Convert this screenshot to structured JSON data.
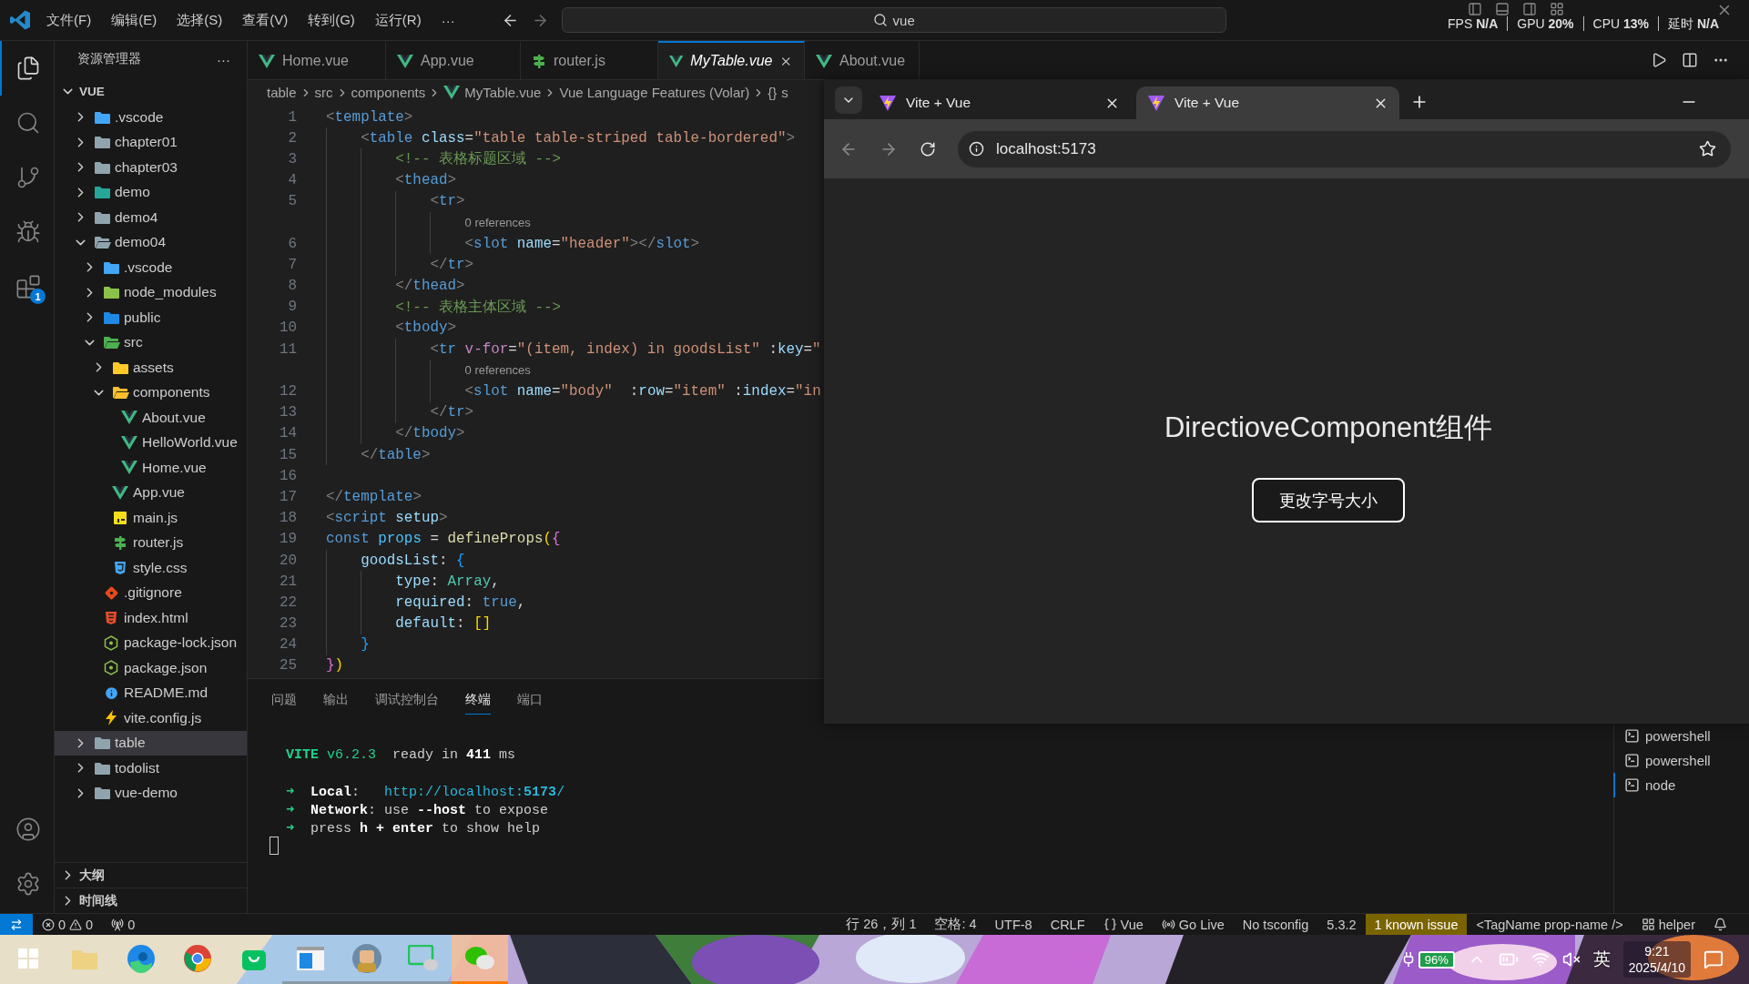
{
  "title_bar": {
    "menus": [
      "文件(F)",
      "编辑(E)",
      "选择(S)",
      "查看(V)",
      "转到(G)",
      "运行(R)"
    ],
    "more": "···",
    "search": {
      "value": "vue"
    },
    "stats": [
      {
        "label": "FPS",
        "value": "N/A"
      },
      {
        "label": "GPU",
        "value": "20%"
      },
      {
        "label": "CPU",
        "value": "13%"
      },
      {
        "label": "延时",
        "value": "N/A"
      }
    ]
  },
  "activity_bar": {
    "items": [
      {
        "kind": "explorer",
        "selected": true
      },
      {
        "kind": "search",
        "selected": false
      },
      {
        "kind": "source-control",
        "selected": false
      },
      {
        "kind": "run-debug",
        "selected": false
      },
      {
        "kind": "extensions",
        "selected": false,
        "badge": "1"
      }
    ],
    "bottom": [
      {
        "kind": "accounts"
      },
      {
        "kind": "settings"
      }
    ]
  },
  "sidebar": {
    "title": "资源管理器",
    "more": "···",
    "section": {
      "label": "VUE",
      "expanded": true
    },
    "tree": [
      {
        "label": ".vscode",
        "kind": "vscode",
        "expanded": false,
        "selected": false
      },
      {
        "label": "chapter01",
        "kind": "folder",
        "expanded": false,
        "selected": false
      },
      {
        "label": "chapter03",
        "kind": "folder",
        "expanded": false,
        "selected": false
      },
      {
        "label": "demo",
        "kind": "demo",
        "expanded": false,
        "selected": false
      },
      {
        "label": "demo4",
        "kind": "folder",
        "expanded": false,
        "selected": false
      },
      {
        "label": "demo04",
        "kind": "folder",
        "expanded": true,
        "selected": false,
        "children": [
          {
            "label": ".vscode",
            "kind": "vscode",
            "expanded": false,
            "selected": false
          },
          {
            "label": "node_modules",
            "kind": "node",
            "expanded": false,
            "selected": false
          },
          {
            "label": "public",
            "kind": "public",
            "expanded": false,
            "selected": false
          },
          {
            "label": "src",
            "kind": "src",
            "expanded": true,
            "selected": false,
            "children": [
              {
                "label": "assets",
                "kind": "assets",
                "expanded": false,
                "selected": false
              },
              {
                "label": "components",
                "kind": "components",
                "expanded": true,
                "selected": false,
                "children": [
                  {
                    "label": "About.vue",
                    "kind": "vue",
                    "selected": false
                  },
                  {
                    "label": "HelloWorld.vue",
                    "kind": "vue",
                    "selected": false
                  },
                  {
                    "label": "Home.vue",
                    "kind": "vue",
                    "selected": false
                  }
                ]
              },
              {
                "label": "App.vue",
                "kind": "vue",
                "selected": false
              },
              {
                "label": "main.js",
                "kind": "js",
                "selected": false
              },
              {
                "label": "router.js",
                "kind": "router",
                "selected": false
              },
              {
                "label": "style.css",
                "kind": "css",
                "selected": false
              }
            ]
          },
          {
            "label": ".gitignore",
            "kind": "git",
            "selected": false
          },
          {
            "label": "index.html",
            "kind": "html",
            "selected": false
          },
          {
            "label": "package-lock.json",
            "kind": "json",
            "selected": false
          },
          {
            "label": "package.json",
            "kind": "json",
            "selected": false
          },
          {
            "label": "README.md",
            "kind": "info",
            "selected": false
          },
          {
            "label": "vite.config.js",
            "kind": "vite",
            "selected": false
          }
        ]
      },
      {
        "label": "table",
        "kind": "folder",
        "expanded": false,
        "selected": true
      },
      {
        "label": "todolist",
        "kind": "folder",
        "expanded": false,
        "selected": false
      },
      {
        "label": "vue-demo",
        "kind": "folder",
        "expanded": false,
        "selected": false
      }
    ],
    "bottom_sections": [
      {
        "label": "大纲",
        "expanded": false
      },
      {
        "label": "时间线",
        "expanded": false
      }
    ]
  },
  "editor": {
    "tabs": [
      {
        "label": "Home.vue",
        "kind": "vue",
        "selected": false,
        "preview": false
      },
      {
        "label": "App.vue",
        "kind": "vue",
        "selected": false,
        "preview": false
      },
      {
        "label": "router.js",
        "kind": "router",
        "selected": false,
        "preview": false
      },
      {
        "label": "MyTable.vue",
        "kind": "vue",
        "selected": true,
        "preview": true
      },
      {
        "label": "About.vue",
        "kind": "vue",
        "selected": false,
        "preview": false
      }
    ],
    "breadcrumb": [
      {
        "label": "table"
      },
      {
        "label": "src"
      },
      {
        "label": "components"
      },
      {
        "label": "MyTable.vue",
        "kind": "vue"
      },
      {
        "label": "Vue Language Features (Volar)"
      },
      {
        "label": "s",
        "icon": "{}"
      }
    ],
    "lines": [
      {
        "kind": "code",
        "n": "1",
        "text": "<template>"
      },
      {
        "kind": "code",
        "n": "2",
        "text": "    <table class=\"table table-striped table-bordered\">"
      },
      {
        "kind": "code",
        "n": "3",
        "text": "        <!-- 表格标题区域 -->"
      },
      {
        "kind": "code",
        "n": "4",
        "text": "        <thead>"
      },
      {
        "kind": "code",
        "n": "5",
        "text": "            <tr>"
      },
      {
        "kind": "lens",
        "text": "0 references"
      },
      {
        "kind": "code",
        "n": "6",
        "text": "                <slot name=\"header\"></slot>"
      },
      {
        "kind": "code",
        "n": "7",
        "text": "            </tr>"
      },
      {
        "kind": "code",
        "n": "8",
        "text": "        </thead>"
      },
      {
        "kind": "code",
        "n": "9",
        "text": "        <!-- 表格主体区域 -->"
      },
      {
        "kind": "code",
        "n": "10",
        "text": "        <tbody>"
      },
      {
        "kind": "code",
        "n": "11",
        "text": "            <tr v-for=\"(item, index) in goodsList\" :key=\""
      },
      {
        "kind": "lens",
        "text": "0 references"
      },
      {
        "kind": "code",
        "n": "12",
        "text": "                <slot name=\"body\"  :row=\"item\" :index=\"in"
      },
      {
        "kind": "code",
        "n": "13",
        "text": "            </tr>"
      },
      {
        "kind": "code",
        "n": "14",
        "text": "        </tbody>"
      },
      {
        "kind": "code",
        "n": "15",
        "text": "    </table>"
      },
      {
        "kind": "code",
        "n": "16"
      },
      {
        "kind": "code",
        "n": "17",
        "text": "</template>"
      },
      {
        "kind": "code",
        "n": "18",
        "text": "<script setup>"
      },
      {
        "kind": "code",
        "n": "19",
        "text": "const props = defineProps({"
      },
      {
        "kind": "code",
        "n": "20",
        "text": "    goodsList: {"
      },
      {
        "kind": "code",
        "n": "21",
        "text": "        type: Array,"
      },
      {
        "kind": "code",
        "n": "22",
        "text": "        required: true,"
      },
      {
        "kind": "code",
        "n": "23",
        "text": "        default: []"
      },
      {
        "kind": "code",
        "n": "24",
        "text": "    }"
      },
      {
        "kind": "code",
        "n": "25",
        "text": "})"
      }
    ]
  },
  "panel": {
    "tabs": [
      {
        "label": "问题",
        "selected": false
      },
      {
        "label": "输出",
        "selected": false
      },
      {
        "label": "调试控制台",
        "selected": false
      },
      {
        "label": "终端",
        "selected": true
      },
      {
        "label": "端口",
        "selected": false
      }
    ],
    "terminal": [
      {
        "lines": [
          "  **VITE** v6.2.3  ready in **411** ms"
        ]
      },
      {
        "lines": [
          "  ➜  **Local**:   http://localhost:**5173**/",
          "  ➜  **Network**: use **--host** to expose",
          "  ➜  press **h + enter** to show help"
        ]
      }
    ],
    "terminals": [
      {
        "label": "powershell",
        "selected": false
      },
      {
        "label": "powershell",
        "selected": false
      },
      {
        "label": "node",
        "selected": true
      }
    ]
  },
  "browser": {
    "tabs": [
      {
        "title": "Vite + Vue",
        "selected": false
      },
      {
        "title": "Vite + Vue",
        "selected": true
      }
    ],
    "url": "localhost:5173",
    "heading": "DirectioveComponent组件",
    "button": "更改字号大小"
  },
  "status_bar": {
    "errors": "0",
    "warnings": "0",
    "ports": "0",
    "items": [
      {
        "kind": "text",
        "text": "行 26，列 1"
      },
      {
        "kind": "text",
        "text": "空格: 4"
      },
      {
        "kind": "text",
        "text": "UTF-8"
      },
      {
        "kind": "text",
        "text": "CRLF"
      },
      {
        "kind": "braces",
        "text": "Vue"
      },
      {
        "kind": "broadcast",
        "text": "Go Live"
      },
      {
        "kind": "text",
        "text": "No tsconfig"
      },
      {
        "kind": "text",
        "text": "5.3.2"
      },
      {
        "kind": "warning",
        "text": "1 known issue"
      },
      {
        "kind": "text",
        "text": "<TagName prop-name />"
      },
      {
        "kind": "layout",
        "text": "helper"
      }
    ]
  },
  "taskbar": {
    "apps": [
      {
        "kind": "windows",
        "running": false,
        "selected": false
      },
      {
        "kind": "folder",
        "running": false,
        "selected": false
      },
      {
        "kind": "edge",
        "running": false,
        "selected": false
      },
      {
        "kind": "chrome",
        "running": false,
        "selected": false
      },
      {
        "kind": "store",
        "running": false,
        "selected": false
      },
      {
        "kind": "window",
        "running": true,
        "selected": false
      },
      {
        "kind": "game",
        "running": true,
        "selected": false
      },
      {
        "kind": "screen",
        "running": true,
        "selected": false
      },
      {
        "kind": "chat",
        "running": true,
        "selected": true
      }
    ],
    "battery": "96%",
    "ime": "英",
    "time": "9:21",
    "date": "2025/4/10"
  }
}
